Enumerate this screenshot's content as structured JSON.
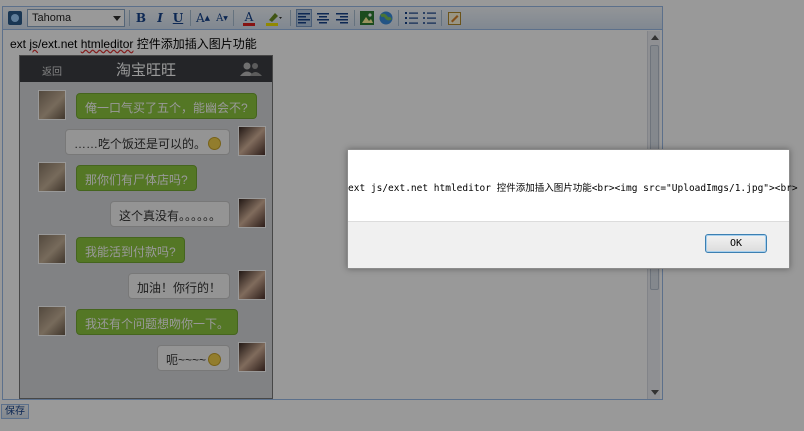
{
  "toolbar": {
    "font_name": "Tahoma",
    "bold": "B",
    "italic": "I",
    "underline": "U",
    "grow_font": "A",
    "shrink_font": "A",
    "font_color": "A"
  },
  "editor": {
    "text_prefix": "ext ",
    "text_js": "js",
    "text_mid": "/ext.net ",
    "text_htmleditor": "htmleditor",
    "text_suffix": " 控件添加插入图片功能"
  },
  "phone_image": {
    "back_label": "返回",
    "title": "淘宝旺旺",
    "messages": [
      {
        "side": "left",
        "style": "green",
        "text": "俺一口气买了五个，能幽会不?"
      },
      {
        "side": "right",
        "style": "white",
        "text": "……吃个饭还是可以的。"
      },
      {
        "side": "left",
        "style": "green",
        "text": "那你们有尸体店吗?"
      },
      {
        "side": "right",
        "style": "white",
        "text": "这个真没有。。。。。。"
      },
      {
        "side": "left",
        "style": "green",
        "text": "我能活到付款吗?"
      },
      {
        "side": "right",
        "style": "white",
        "text": "加油！你行的！"
      },
      {
        "side": "left",
        "style": "green",
        "text": "我还有个问题想吻你一下。"
      },
      {
        "side": "right",
        "style": "white",
        "text": "呃~~~~"
      }
    ]
  },
  "save_button": "保存",
  "dialog": {
    "message": "ext js/ext.net htmleditor 控件添加插入图片功能<br><img src=\"UploadImgs/1.jpg\"><br>",
    "ok_label": "OK"
  }
}
